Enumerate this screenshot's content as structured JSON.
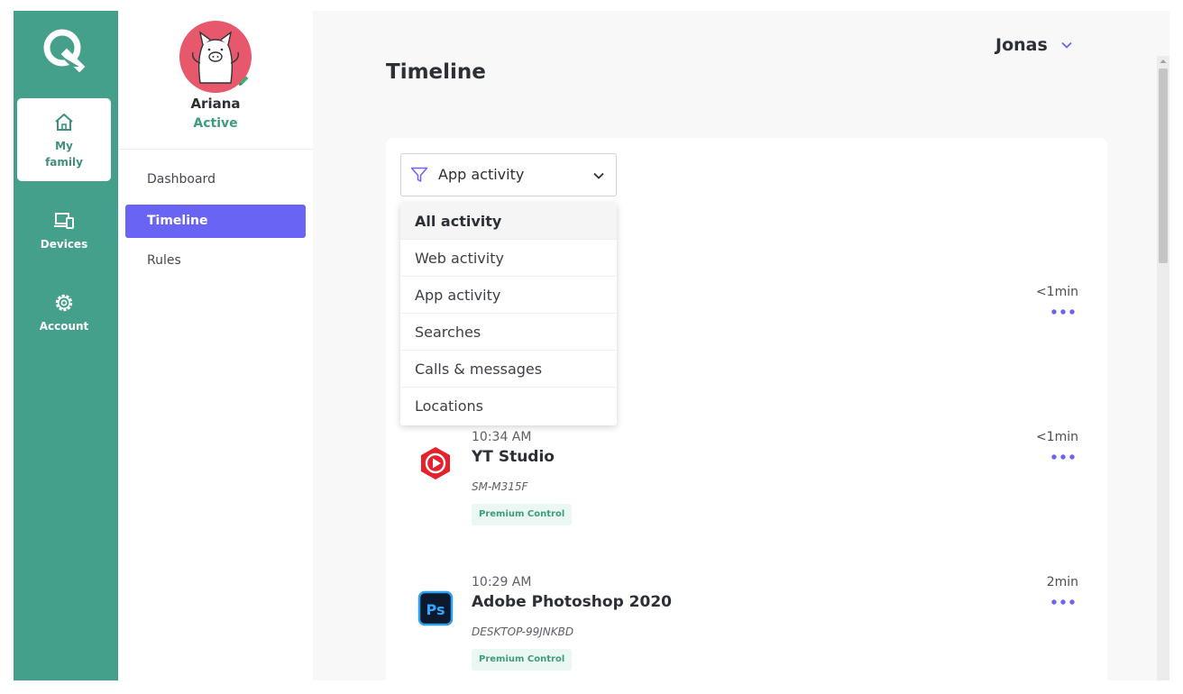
{
  "rail": {
    "items": [
      {
        "label": "My family",
        "icon": "home-icon",
        "active": true
      },
      {
        "label": "Devices",
        "icon": "devices-icon",
        "active": false
      },
      {
        "label": "Account",
        "icon": "gear-icon",
        "active": false
      }
    ]
  },
  "profile": {
    "name": "Ariana",
    "status": "Active"
  },
  "nav": {
    "items": [
      {
        "label": "Dashboard",
        "active": false
      },
      {
        "label": "Timeline",
        "active": true
      },
      {
        "label": "Rules",
        "active": false
      }
    ]
  },
  "user": {
    "name": "Jonas"
  },
  "page": {
    "title": "Timeline"
  },
  "filter": {
    "selected": "App activity",
    "options": [
      "All activity",
      "Web activity",
      "App activity",
      "Searches",
      "Calls & messages",
      "Locations"
    ],
    "highlighted": "All activity"
  },
  "timeline": {
    "partial_entry": {
      "duration": "<1min"
    },
    "entries": [
      {
        "time": "10:34 AM",
        "app": "YT Studio",
        "device": "SM-M315F",
        "badge": "Premium Control",
        "duration": "<1min",
        "icon": "yt-studio-icon"
      },
      {
        "time": "10:29 AM",
        "app": "Adobe Photoshop 2020",
        "device": "DESKTOP-99JNKBD",
        "badge": "Premium Control",
        "duration": "2min",
        "icon": "photoshop-icon"
      }
    ]
  },
  "colors": {
    "rail": "#44a08a",
    "accent": "#6a64f5",
    "active_green": "#3f9b7e"
  }
}
